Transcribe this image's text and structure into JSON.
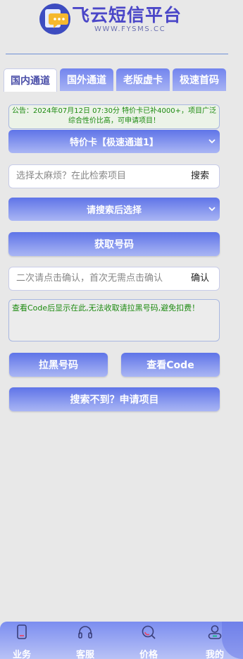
{
  "brand": {
    "title": "飞云短信平台",
    "subtitle": "WWW.FYSMS.CC"
  },
  "tabs": [
    {
      "label": "国内通道",
      "active": true
    },
    {
      "label": "国外通道",
      "active": false
    },
    {
      "label": "老版虚卡",
      "active": false
    },
    {
      "label": "极速首码",
      "active": false
    }
  ],
  "notice": "公告：2024年07月12日 07:30分 特价卡已补4000+，项目广泛 综合性价比高，可申请项目！",
  "channel_select": {
    "value": "特价卡【极速通道1】"
  },
  "search": {
    "placeholder": "选择太麻烦？在此检索项目",
    "button": "搜索"
  },
  "project_select": {
    "value": "请搜索后选择"
  },
  "get_number_button": "获取号码",
  "confirm": {
    "placeholder": "二次请点击确认，首次无需点击确认",
    "button": "确认"
  },
  "code_hint": "查看Code后显示在此,无法收取请拉黑号码,避免扣费！",
  "blacklist_button": "拉黑号码",
  "view_code_button": "查看Code",
  "request_project_button": "搜索不到？申请项目",
  "bottom_nav": [
    {
      "label": "业务",
      "icon": "phone-icon"
    },
    {
      "label": "客服",
      "icon": "headset-icon"
    },
    {
      "label": "价格",
      "icon": "search-icon"
    },
    {
      "label": "我的",
      "icon": "user-icon"
    }
  ],
  "colors": {
    "accent": "#5f74e8",
    "accent_light": "#aab6f4",
    "brand_text": "#4b47c8",
    "notice_text": "#1c8a10"
  }
}
